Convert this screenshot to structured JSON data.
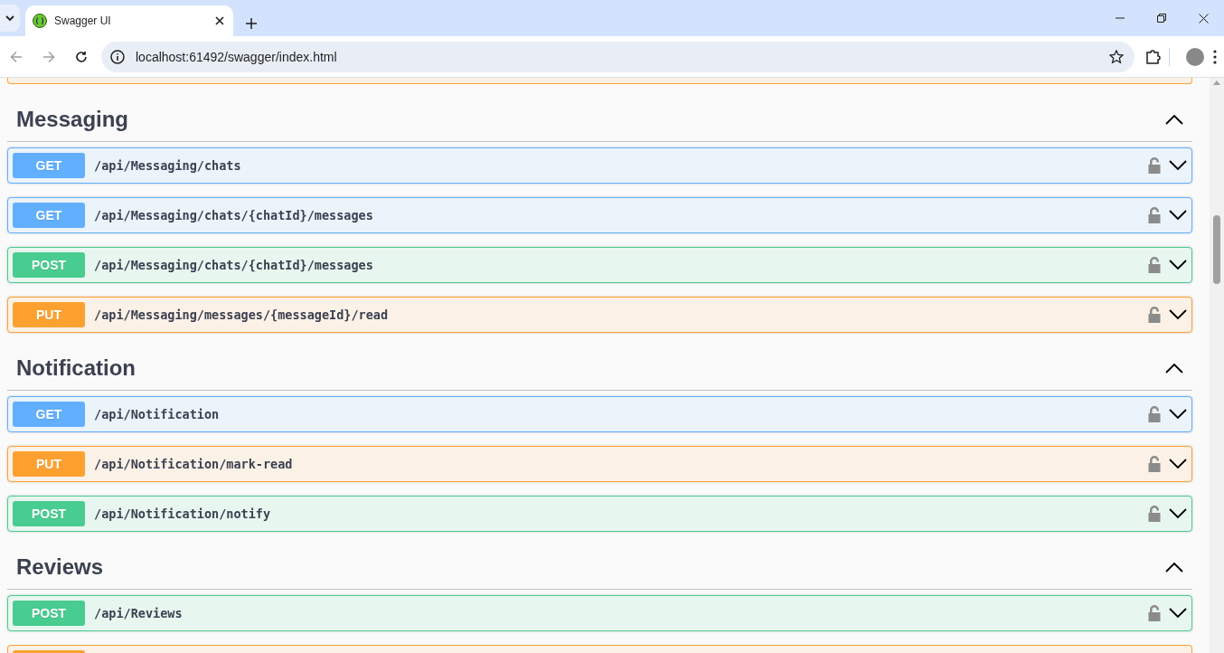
{
  "browser": {
    "tab": {
      "title": "Swagger UI"
    },
    "url": "localhost:61492/swagger/index.html"
  },
  "cut_op_above": {
    "kind": "put"
  },
  "sections": [
    {
      "name": "Messaging",
      "expanded": true,
      "operations": [
        {
          "kind": "get",
          "method": "GET",
          "path": "/api/Messaging/chats"
        },
        {
          "kind": "get",
          "method": "GET",
          "path": "/api/Messaging/chats/{chatId}/messages"
        },
        {
          "kind": "post",
          "method": "POST",
          "path": "/api/Messaging/chats/{chatId}/messages"
        },
        {
          "kind": "put",
          "method": "PUT",
          "path": "/api/Messaging/messages/{messageId}/read"
        }
      ]
    },
    {
      "name": "Notification",
      "expanded": true,
      "operations": [
        {
          "kind": "get",
          "method": "GET",
          "path": "/api/Notification"
        },
        {
          "kind": "put",
          "method": "PUT",
          "path": "/api/Notification/mark-read"
        },
        {
          "kind": "post",
          "method": "POST",
          "path": "/api/Notification/notify"
        }
      ]
    },
    {
      "name": "Reviews",
      "expanded": true,
      "operations": [
        {
          "kind": "post",
          "method": "POST",
          "path": "/api/Reviews"
        }
      ]
    }
  ],
  "cut_op_below": {
    "kind": "put"
  }
}
